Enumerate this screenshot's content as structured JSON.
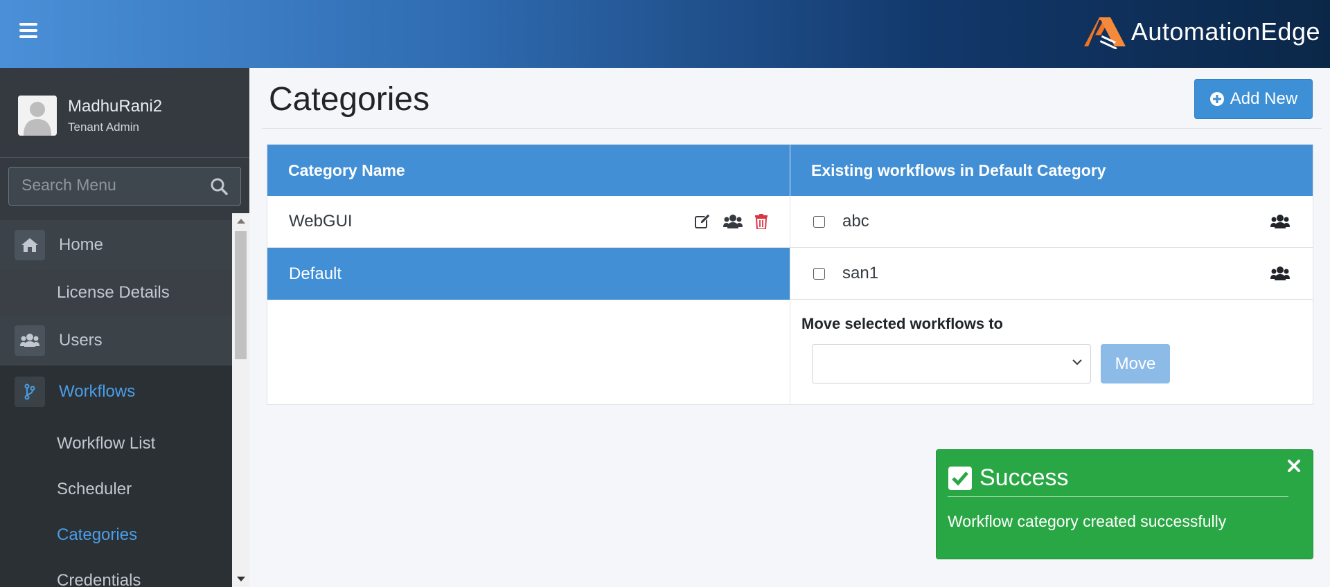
{
  "topbar": {
    "brand": "AutomationEdge"
  },
  "user": {
    "name": "MadhuRani2",
    "role": "Tenant Admin"
  },
  "search": {
    "placeholder": "Search Menu"
  },
  "menu": {
    "home": "Home",
    "license": "License Details",
    "users": "Users",
    "workflows": "Workflows",
    "workflow_list": "Workflow List",
    "scheduler": "Scheduler",
    "categories": "Categories",
    "credentials": "Credentials"
  },
  "page": {
    "title": "Categories",
    "add_label": "Add New"
  },
  "categories_panel": {
    "header": "Category Name",
    "rows": [
      "WebGUI",
      "Default"
    ]
  },
  "workflows_panel": {
    "header": "Existing workflows in Default Category",
    "rows": [
      "abc",
      "san1"
    ],
    "move_label": "Move selected workflows to",
    "move_button": "Move"
  },
  "toast": {
    "title": "Success",
    "message": "Workflow category created successfully"
  },
  "colors": {
    "accent": "#428fd6",
    "sidebar": "#343a40",
    "success": "#2aa745",
    "danger": "#dc3545",
    "active_menu": "#4a9ee6"
  }
}
